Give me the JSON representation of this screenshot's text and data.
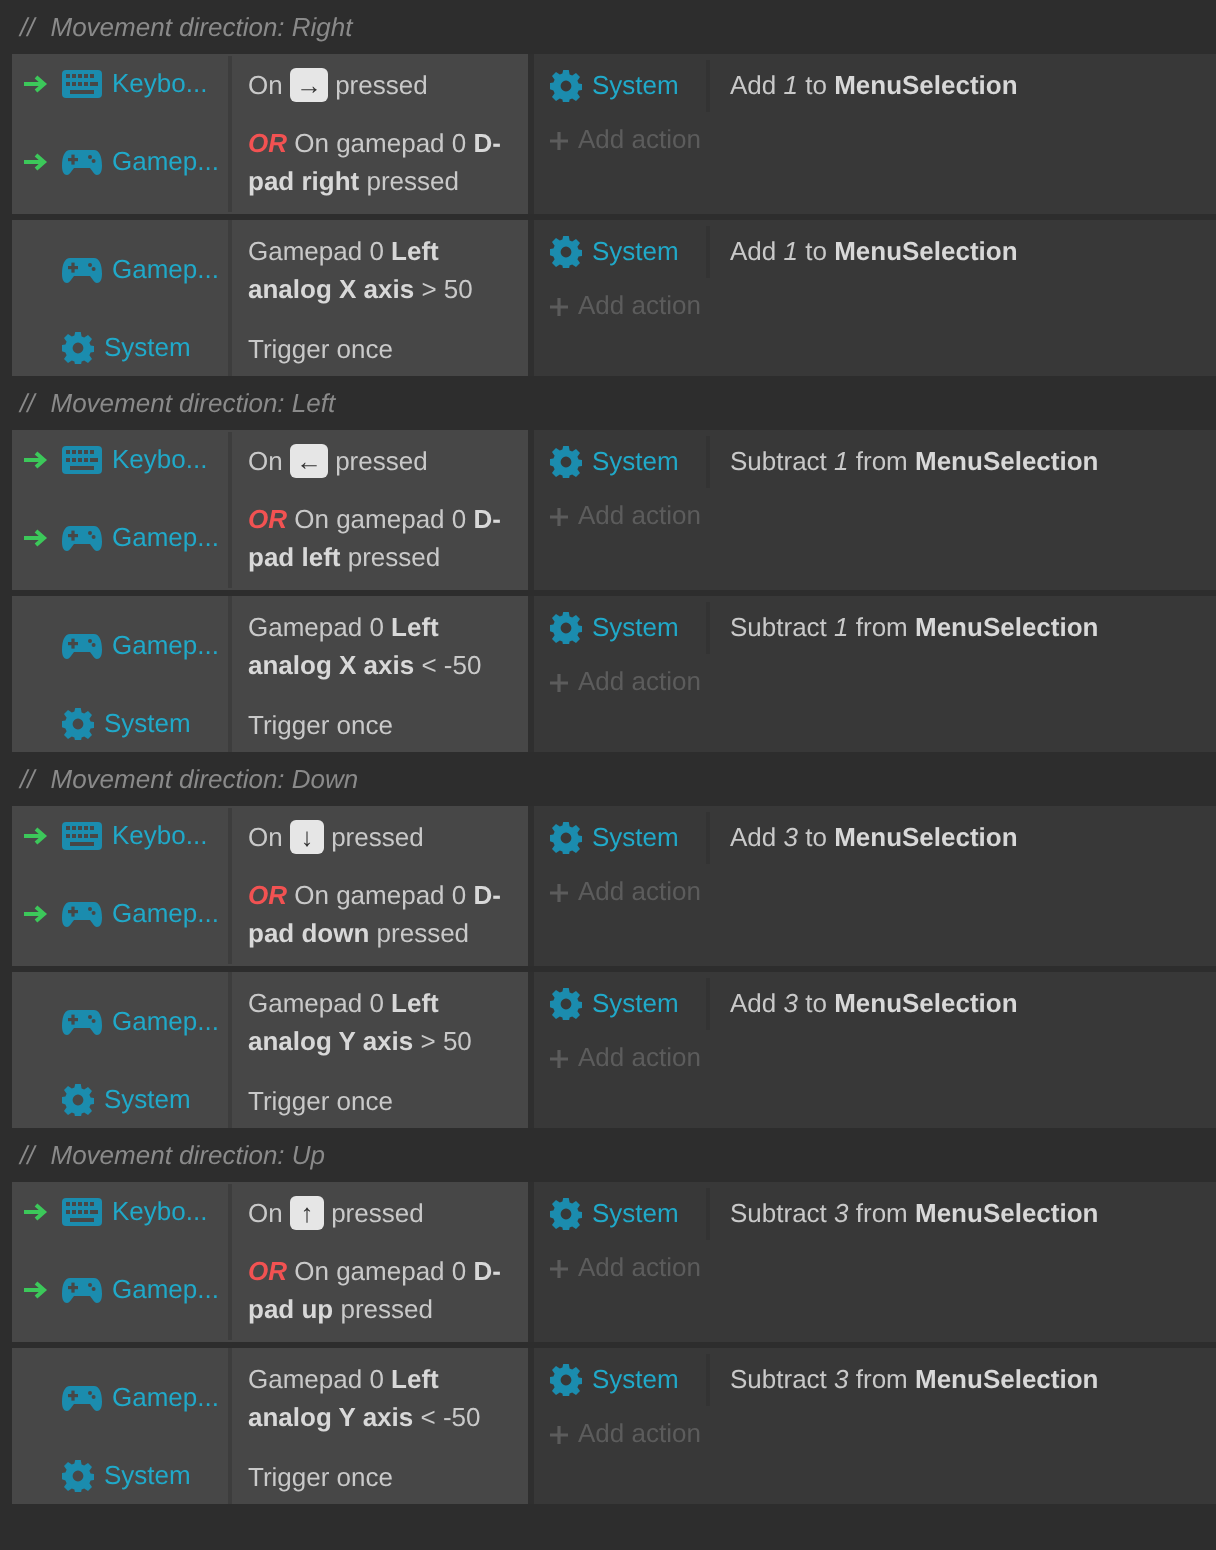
{
  "groups": [
    {
      "comment_mark": "//",
      "comment": "Movement direction: Right",
      "events": [
        {
          "conditions": [
            {
              "trigger": true,
              "kind": "keyboard",
              "object": "Keybo...",
              "prefix": "On",
              "key": "→",
              "suffix": "pressed"
            },
            {
              "trigger": true,
              "kind": "gamepad",
              "object": "Gamep...",
              "or_label": "OR",
              "text": "On gamepad 0 **D-pad right** pressed"
            }
          ],
          "actions": [
            {
              "kind": "system",
              "object": "System",
              "text": "Add *1* to **MenuSelection**"
            }
          ],
          "add_action": "Add action"
        },
        {
          "conditions": [
            {
              "trigger": false,
              "kind": "gamepad",
              "object": "Gamep...",
              "text": "Gamepad 0 **Left analog X axis** > 50"
            },
            {
              "trigger": false,
              "kind": "system",
              "object": "System",
              "text": "Trigger once"
            }
          ],
          "actions": [
            {
              "kind": "system",
              "object": "System",
              "text": "Add *1* to **MenuSelection**"
            }
          ],
          "add_action": "Add action"
        }
      ]
    },
    {
      "comment_mark": "//",
      "comment": "Movement direction: Left",
      "events": [
        {
          "conditions": [
            {
              "trigger": true,
              "kind": "keyboard",
              "object": "Keybo...",
              "prefix": "On",
              "key": "←",
              "suffix": "pressed"
            },
            {
              "trigger": true,
              "kind": "gamepad",
              "object": "Gamep...",
              "or_label": "OR",
              "text": "On gamepad 0 **D-pad left** pressed"
            }
          ],
          "actions": [
            {
              "kind": "system",
              "object": "System",
              "text": "Subtract *1* from **MenuSelection**"
            }
          ],
          "add_action": "Add action"
        },
        {
          "conditions": [
            {
              "trigger": false,
              "kind": "gamepad",
              "object": "Gamep...",
              "text": "Gamepad 0 **Left analog X axis** < -50"
            },
            {
              "trigger": false,
              "kind": "system",
              "object": "System",
              "text": "Trigger once"
            }
          ],
          "actions": [
            {
              "kind": "system",
              "object": "System",
              "text": "Subtract *1* from **MenuSelection**"
            }
          ],
          "add_action": "Add action"
        }
      ]
    },
    {
      "comment_mark": "//",
      "comment": "Movement direction: Down",
      "events": [
        {
          "conditions": [
            {
              "trigger": true,
              "kind": "keyboard",
              "object": "Keybo...",
              "prefix": "On",
              "key": "↓",
              "suffix": "pressed"
            },
            {
              "trigger": true,
              "kind": "gamepad",
              "object": "Gamep...",
              "or_label": "OR",
              "text": "On gamepad 0 **D-pad down** pressed"
            }
          ],
          "actions": [
            {
              "kind": "system",
              "object": "System",
              "text": "Add *3* to **MenuSelection**"
            }
          ],
          "add_action": "Add action"
        },
        {
          "conditions": [
            {
              "trigger": false,
              "kind": "gamepad",
              "object": "Gamep...",
              "text": "Gamepad 0 **Left analog Y axis** > 50"
            },
            {
              "trigger": false,
              "kind": "system",
              "object": "System",
              "text": "Trigger once"
            }
          ],
          "actions": [
            {
              "kind": "system",
              "object": "System",
              "text": "Add *3* to **MenuSelection**"
            }
          ],
          "add_action": "Add action"
        }
      ]
    },
    {
      "comment_mark": "//",
      "comment": "Movement direction: Up",
      "events": [
        {
          "conditions": [
            {
              "trigger": true,
              "kind": "keyboard",
              "object": "Keybo...",
              "prefix": "On",
              "key": "↑",
              "suffix": "pressed"
            },
            {
              "trigger": true,
              "kind": "gamepad",
              "object": "Gamep...",
              "or_label": "OR",
              "text": "On gamepad 0 **D-pad up** pressed"
            }
          ],
          "actions": [
            {
              "kind": "system",
              "object": "System",
              "text": "Subtract *3* from **MenuSelection**"
            }
          ],
          "add_action": "Add action"
        },
        {
          "conditions": [
            {
              "trigger": false,
              "kind": "gamepad",
              "object": "Gamep...",
              "text": "Gamepad 0 **Left analog Y axis** < -50"
            },
            {
              "trigger": false,
              "kind": "system",
              "object": "System",
              "text": "Trigger once"
            }
          ],
          "actions": [
            {
              "kind": "system",
              "object": "System",
              "text": "Subtract *3* from **MenuSelection**"
            }
          ],
          "add_action": "Add action"
        }
      ]
    }
  ]
}
